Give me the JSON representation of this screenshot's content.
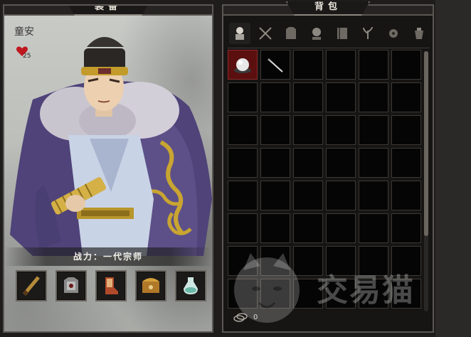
{
  "equipment": {
    "title": "装备",
    "character_name": "童安",
    "health_value": "25",
    "power_label": "战力：一代宗师",
    "slots": [
      {
        "icon": "sword-icon"
      },
      {
        "icon": "armor-icon"
      },
      {
        "icon": "boots-icon"
      },
      {
        "icon": "treasure-icon"
      },
      {
        "icon": "potion-icon"
      }
    ]
  },
  "bag": {
    "title": "背包",
    "tabs": [
      {
        "icon": "all-items-icon"
      },
      {
        "icon": "weapons-icon"
      },
      {
        "icon": "armor-icon"
      },
      {
        "icon": "accessory-icon"
      },
      {
        "icon": "book-icon"
      },
      {
        "icon": "herb-icon"
      },
      {
        "icon": "material-icon"
      },
      {
        "icon": "misc-icon"
      }
    ],
    "items": [
      {
        "icon": "pearl-icon",
        "selected": true
      },
      {
        "icon": "needle-icon",
        "selected": false
      }
    ],
    "money": "0"
  },
  "watermark": {
    "text": "交易猫"
  },
  "colors": {
    "selected_cell": "#5b0f0f",
    "heart": "#c0181f"
  }
}
